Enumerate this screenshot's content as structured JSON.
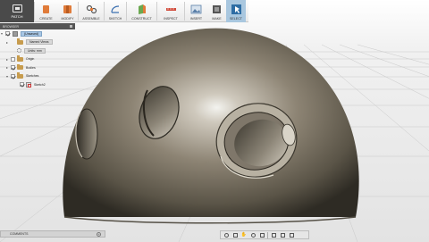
{
  "toolbar": {
    "workspace_label": "PATCH",
    "tools": [
      {
        "label": "CREATE",
        "icon": "create-icon",
        "color": "#e07b39"
      },
      {
        "label": "MODIFY",
        "icon": "modify-icon",
        "color": "#e07b39"
      },
      {
        "label": "ASSEMBLE",
        "icon": "assemble-icon",
        "color": "#6b6b6b"
      },
      {
        "label": "SKETCH",
        "icon": "sketch-icon",
        "color": "#3b6fb0"
      },
      {
        "label": "CONSTRUCT",
        "icon": "construct-icon",
        "color": "#e07b39"
      },
      {
        "label": "INSPECT",
        "icon": "inspect-icon",
        "color": "#d14a3a"
      },
      {
        "label": "INSERT",
        "icon": "insert-icon",
        "color": "#5a7fa8"
      },
      {
        "label": "MAKE",
        "icon": "make-icon",
        "color": "#555555"
      },
      {
        "label": "SELECT",
        "icon": "select-icon",
        "color": "#2e6da4"
      }
    ],
    "selected_tool": "SELECT"
  },
  "browser": {
    "title": "BROWSER",
    "root_label": "(Unsaved)",
    "named_views": "Named Views",
    "units": "Units: mm",
    "origin": "Origin",
    "bodies": "Bodies",
    "sketches": "Sketches",
    "sketch_item": "Sketch2"
  },
  "comments": {
    "label": "COMMENTS"
  },
  "colors": {
    "accent": "#a8c6e4",
    "sphere_highlight": "#f3f3f0",
    "sphere_shadow": "#2e2b24"
  }
}
